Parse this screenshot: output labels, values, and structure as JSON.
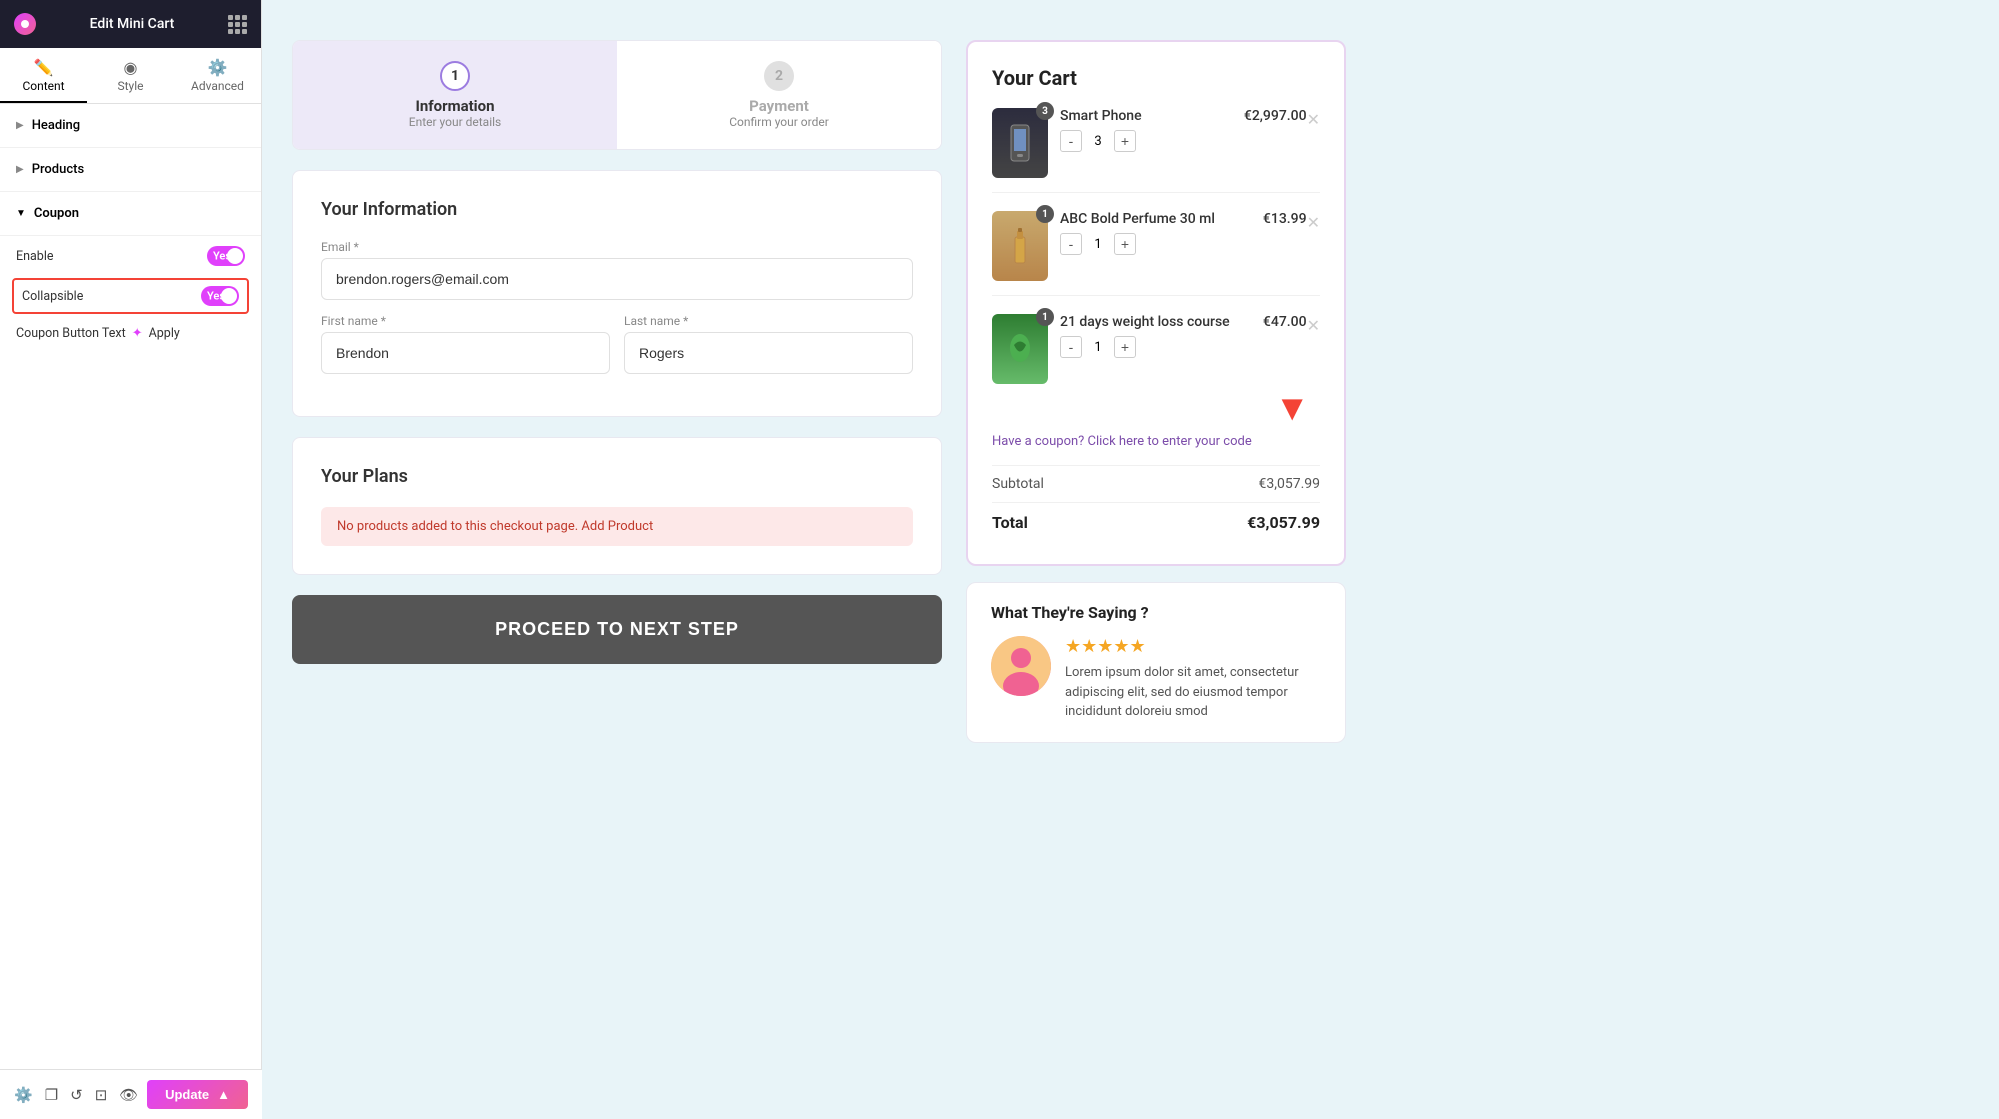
{
  "sidebar": {
    "title": "Edit Mini Cart",
    "tabs": [
      {
        "label": "Content",
        "icon": "✏️",
        "active": true
      },
      {
        "label": "Style",
        "icon": "◉",
        "active": false
      },
      {
        "label": "Advanced",
        "icon": "⚙️",
        "active": false
      }
    ],
    "sections": [
      {
        "label": "Heading",
        "expanded": false
      },
      {
        "label": "Products",
        "expanded": false
      },
      {
        "label": "Coupon",
        "expanded": true
      }
    ],
    "coupon": {
      "enable_label": "Enable",
      "enable_value": "Yes",
      "collapsible_label": "Collapsible",
      "collapsible_value": "Yes",
      "button_text_label": "Coupon Button Text",
      "button_text_value": "Apply"
    },
    "update_button": "Update"
  },
  "steps": [
    {
      "number": "1",
      "title": "Information",
      "subtitle": "Enter your details",
      "active": true
    },
    {
      "number": "2",
      "title": "Payment",
      "subtitle": "Confirm your order",
      "active": false
    }
  ],
  "information_form": {
    "title": "Your Information",
    "email_label": "Email *",
    "email_value": "brendon.rogers@email.com",
    "first_name_label": "First name *",
    "first_name_value": "Brendon",
    "last_name_label": "Last name *",
    "last_name_value": "Rogers"
  },
  "plans": {
    "title": "Your Plans",
    "warning": "No products added to this checkout page. Add Product"
  },
  "proceed_button": "PROCEED TO NEXT STEP",
  "cart": {
    "title": "Your Cart",
    "items": [
      {
        "name": "Smart Phone",
        "price": "€2,997.00",
        "quantity": 3,
        "badge": 3
      },
      {
        "name": "ABC Bold Perfume 30 ml",
        "price": "€13.99",
        "quantity": 1,
        "badge": 1
      },
      {
        "name": "21 days weight loss course",
        "price": "€47.00",
        "quantity": 1,
        "badge": 1
      }
    ],
    "coupon_link": "Have a coupon? Click here to enter your code",
    "subtotal_label": "Subtotal",
    "subtotal_value": "€3,057.99",
    "total_label": "Total",
    "total_value": "€3,057.99"
  },
  "testimonial": {
    "title": "What They're Saying ?",
    "stars": "★★★★★",
    "text": "Lorem ipsum dolor sit amet, consectetur adipiscing elit, sed do eiusmod tempor incididunt doloreiu smod"
  }
}
